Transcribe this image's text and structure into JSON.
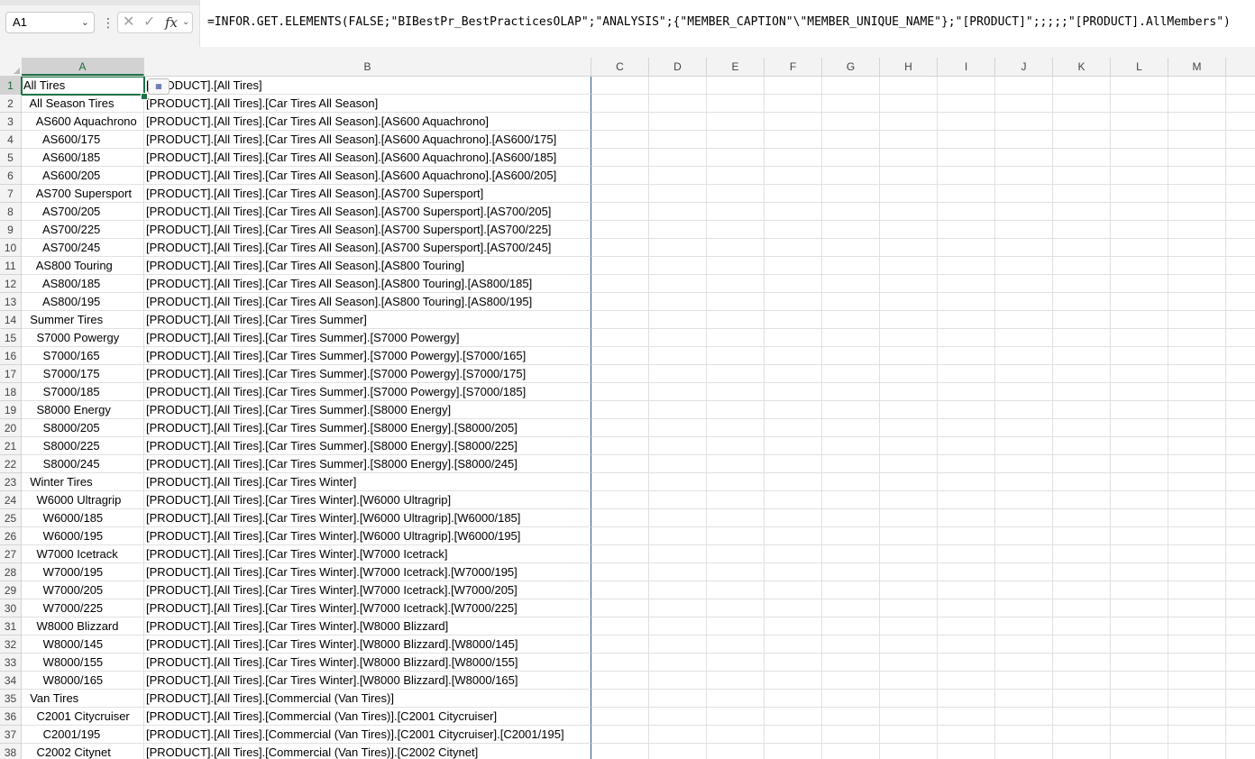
{
  "formula_bar": {
    "name_box": "A1",
    "formula": "=INFOR.GET.ELEMENTS(FALSE;\"BIBestPr_BestPracticesOLAP\";\"ANALYSIS\";{\"MEMBER_CAPTION\"\\\"MEMBER_UNIQUE_NAME\"};\"[PRODUCT]\";;;;;\"[PRODUCT].AllMembers\")",
    "fx_label": "fx"
  },
  "columns": [
    "A",
    "B",
    "C",
    "D",
    "E",
    "F",
    "G",
    "H",
    "I",
    "J",
    "K",
    "L",
    "M"
  ],
  "rows": [
    {
      "n": "1",
      "a": "All Tires",
      "b": "[PRODUCT].[All Tires]"
    },
    {
      "n": "2",
      "a": "  All Season Tires",
      "b": "[PRODUCT].[All Tires].[Car Tires All Season]"
    },
    {
      "n": "3",
      "a": "    AS600 Aquachrono",
      "b": "[PRODUCT].[All Tires].[Car Tires All Season].[AS600 Aquachrono]"
    },
    {
      "n": "4",
      "a": "      AS600/175",
      "b": "[PRODUCT].[All Tires].[Car Tires All Season].[AS600 Aquachrono].[AS600/175]"
    },
    {
      "n": "5",
      "a": "      AS600/185",
      "b": "[PRODUCT].[All Tires].[Car Tires All Season].[AS600 Aquachrono].[AS600/185]"
    },
    {
      "n": "6",
      "a": "      AS600/205",
      "b": "[PRODUCT].[All Tires].[Car Tires All Season].[AS600 Aquachrono].[AS600/205]"
    },
    {
      "n": "7",
      "a": "    AS700 Supersport",
      "b": "[PRODUCT].[All Tires].[Car Tires All Season].[AS700 Supersport]"
    },
    {
      "n": "8",
      "a": "      AS700/205",
      "b": "[PRODUCT].[All Tires].[Car Tires All Season].[AS700 Supersport].[AS700/205]"
    },
    {
      "n": "9",
      "a": "      AS700/225",
      "b": "[PRODUCT].[All Tires].[Car Tires All Season].[AS700 Supersport].[AS700/225]"
    },
    {
      "n": "10",
      "a": "      AS700/245",
      "b": "[PRODUCT].[All Tires].[Car Tires All Season].[AS700 Supersport].[AS700/245]"
    },
    {
      "n": "11",
      "a": "    AS800 Touring",
      "b": "[PRODUCT].[All Tires].[Car Tires All Season].[AS800 Touring]"
    },
    {
      "n": "12",
      "a": "      AS800/185",
      "b": "[PRODUCT].[All Tires].[Car Tires All Season].[AS800 Touring].[AS800/185]"
    },
    {
      "n": "13",
      "a": "      AS800/195",
      "b": "[PRODUCT].[All Tires].[Car Tires All Season].[AS800 Touring].[AS800/195]"
    },
    {
      "n": "14",
      "a": "  Summer Tires",
      "b": "[PRODUCT].[All Tires].[Car Tires Summer]"
    },
    {
      "n": "15",
      "a": "    S7000 Powergy",
      "b": "[PRODUCT].[All Tires].[Car Tires Summer].[S7000 Powergy]"
    },
    {
      "n": "16",
      "a": "      S7000/165",
      "b": "[PRODUCT].[All Tires].[Car Tires Summer].[S7000 Powergy].[S7000/165]"
    },
    {
      "n": "17",
      "a": "      S7000/175",
      "b": "[PRODUCT].[All Tires].[Car Tires Summer].[S7000 Powergy].[S7000/175]"
    },
    {
      "n": "18",
      "a": "      S7000/185",
      "b": "[PRODUCT].[All Tires].[Car Tires Summer].[S7000 Powergy].[S7000/185]"
    },
    {
      "n": "19",
      "a": "    S8000 Energy",
      "b": "[PRODUCT].[All Tires].[Car Tires Summer].[S8000 Energy]"
    },
    {
      "n": "20",
      "a": "      S8000/205",
      "b": "[PRODUCT].[All Tires].[Car Tires Summer].[S8000 Energy].[S8000/205]"
    },
    {
      "n": "21",
      "a": "      S8000/225",
      "b": "[PRODUCT].[All Tires].[Car Tires Summer].[S8000 Energy].[S8000/225]"
    },
    {
      "n": "22",
      "a": "      S8000/245",
      "b": "[PRODUCT].[All Tires].[Car Tires Summer].[S8000 Energy].[S8000/245]"
    },
    {
      "n": "23",
      "a": "  Winter Tires",
      "b": "[PRODUCT].[All Tires].[Car Tires Winter]"
    },
    {
      "n": "24",
      "a": "    W6000 Ultragrip",
      "b": "[PRODUCT].[All Tires].[Car Tires Winter].[W6000 Ultragrip]"
    },
    {
      "n": "25",
      "a": "      W6000/185",
      "b": "[PRODUCT].[All Tires].[Car Tires Winter].[W6000 Ultragrip].[W6000/185]"
    },
    {
      "n": "26",
      "a": "      W6000/195",
      "b": "[PRODUCT].[All Tires].[Car Tires Winter].[W6000 Ultragrip].[W6000/195]"
    },
    {
      "n": "27",
      "a": "    W7000 Icetrack",
      "b": "[PRODUCT].[All Tires].[Car Tires Winter].[W7000 Icetrack]"
    },
    {
      "n": "28",
      "a": "      W7000/195",
      "b": "[PRODUCT].[All Tires].[Car Tires Winter].[W7000 Icetrack].[W7000/195]"
    },
    {
      "n": "29",
      "a": "      W7000/205",
      "b": "[PRODUCT].[All Tires].[Car Tires Winter].[W7000 Icetrack].[W7000/205]"
    },
    {
      "n": "30",
      "a": "      W7000/225",
      "b": "[PRODUCT].[All Tires].[Car Tires Winter].[W7000 Icetrack].[W7000/225]"
    },
    {
      "n": "31",
      "a": "    W8000 Blizzard",
      "b": "[PRODUCT].[All Tires].[Car Tires Winter].[W8000 Blizzard]"
    },
    {
      "n": "32",
      "a": "      W8000/145",
      "b": "[PRODUCT].[All Tires].[Car Tires Winter].[W8000 Blizzard].[W8000/145]"
    },
    {
      "n": "33",
      "a": "      W8000/155",
      "b": "[PRODUCT].[All Tires].[Car Tires Winter].[W8000 Blizzard].[W8000/155]"
    },
    {
      "n": "34",
      "a": "      W8000/165",
      "b": "[PRODUCT].[All Tires].[Car Tires Winter].[W8000 Blizzard].[W8000/165]"
    },
    {
      "n": "35",
      "a": "  Van Tires",
      "b": "[PRODUCT].[All Tires].[Commercial (Van Tires)]"
    },
    {
      "n": "36",
      "a": "    C2001 Citycruiser",
      "b": "[PRODUCT].[All Tires].[Commercial (Van Tires)].[C2001 Citycruiser]"
    },
    {
      "n": "37",
      "a": "      C2001/195",
      "b": "[PRODUCT].[All Tires].[Commercial (Van Tires)].[C2001 Citycruiser].[C2001/195]"
    },
    {
      "n": "38",
      "a": "    C2002 Citynet",
      "b": "[PRODUCT].[All Tires].[Commercial (Van Tires)].[C2002 Citynet]"
    }
  ]
}
